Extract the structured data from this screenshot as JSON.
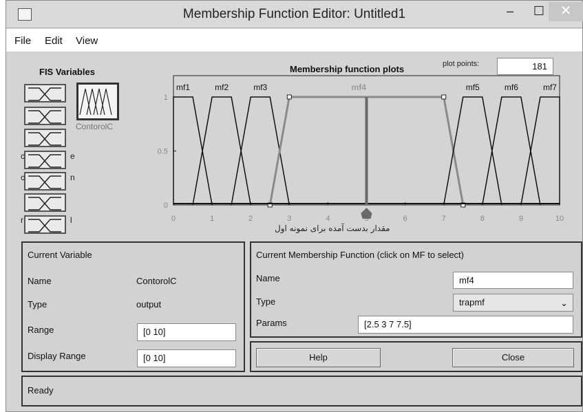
{
  "window": {
    "title": "Membership Function Editor: Untitled1",
    "minimize": "–",
    "maximize": "☐",
    "close": "✕"
  },
  "menubar": {
    "items": [
      "File",
      "Edit",
      "View"
    ]
  },
  "fis": {
    "heading": "FIS Variables",
    "selected_label": "ContorolC",
    "ghost_labels": [
      {
        "text": "c",
        "suffix": "e"
      },
      {
        "text": "c",
        "suffix": "n"
      },
      {
        "text": "r",
        "suffix": "l"
      }
    ]
  },
  "plot": {
    "title": "Membership function plots",
    "plot_points_label": "plot points:",
    "plot_points_value": "181",
    "annotation": "مقدار بدست آمده برای نمونه اول"
  },
  "chart_data": {
    "type": "line",
    "title": "Membership function plots",
    "xlim": [
      0,
      10
    ],
    "ylim": [
      0,
      1
    ],
    "xticks": [
      0,
      1,
      2,
      3,
      4,
      5,
      6,
      7,
      8,
      9,
      10
    ],
    "yticks": [
      0,
      0.5,
      1
    ],
    "series": [
      {
        "name": "mf1",
        "type": "trapmf",
        "params": [
          -1,
          0,
          0.5,
          1
        ]
      },
      {
        "name": "mf2",
        "type": "trapmf",
        "params": [
          0.5,
          1,
          1.5,
          2
        ]
      },
      {
        "name": "mf3",
        "type": "trapmf",
        "params": [
          1.5,
          2,
          2.5,
          3
        ]
      },
      {
        "name": "mf4",
        "type": "trapmf",
        "params": [
          2.5,
          3,
          7,
          7.5
        ],
        "selected": true
      },
      {
        "name": "mf5",
        "type": "trapmf",
        "params": [
          7,
          7.5,
          8,
          8.5
        ]
      },
      {
        "name": "mf6",
        "type": "trapmf",
        "params": [
          8,
          8.5,
          9,
          9.5
        ]
      },
      {
        "name": "mf7",
        "type": "trapmf",
        "params": [
          9,
          9.5,
          10,
          11
        ]
      }
    ],
    "marker_x": 5,
    "colors": {
      "line": "#111111",
      "selected": "#8a8a8a",
      "marker": "#6a6a6a"
    }
  },
  "current_variable": {
    "heading": "Current Variable",
    "name_label": "Name",
    "name_value": "ContorolC",
    "type_label": "Type",
    "type_value": "output",
    "range_label": "Range",
    "range_value": "[0 10]",
    "display_range_label": "Display Range",
    "display_range_value": "[0 10]"
  },
  "current_mf": {
    "heading": "Current Membership Function (click on MF to select)",
    "name_label": "Name",
    "name_value": "mf4",
    "type_label": "Type",
    "type_value": "trapmf",
    "params_label": "Params",
    "params_value": "[2.5 3 7 7.5]"
  },
  "buttons": {
    "help": "Help",
    "close": "Close"
  },
  "status": {
    "text": "Ready"
  }
}
